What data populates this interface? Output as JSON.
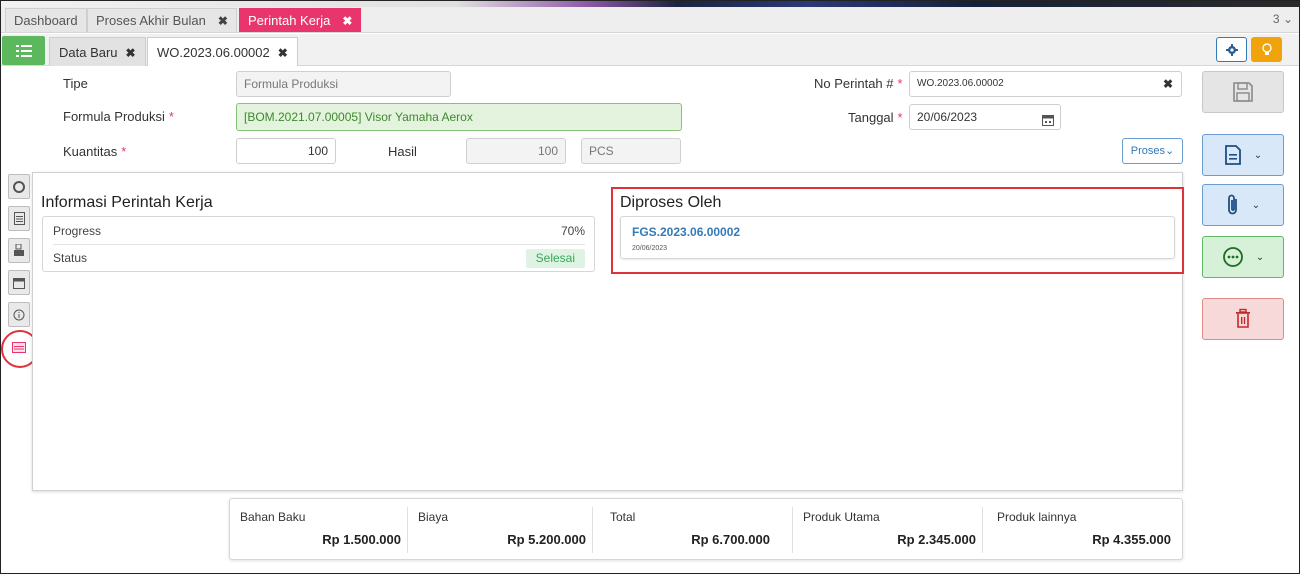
{
  "top_tabs": [
    {
      "label": "Dashboard",
      "closable": false
    },
    {
      "label": "Proses Akhir Bulan",
      "closable": true
    },
    {
      "label": "Perintah Kerja",
      "closable": true
    }
  ],
  "top_tab_count": "3",
  "sub_tabs": [
    {
      "label": "Data Baru",
      "closable": true
    },
    {
      "label": "WO.2023.06.00002",
      "closable": true
    }
  ],
  "form": {
    "tipe_label": "Tipe",
    "tipe_value": "Formula Produksi",
    "formula_label": "Formula Produksi",
    "formula_value": "[BOM.2021.07.00005] Visor Yamaha Aerox",
    "kuantitas_label": "Kuantitas",
    "kuantitas_value": "100",
    "hasil_label": "Hasil",
    "hasil_value": "100",
    "unit_value": "PCS",
    "no_perintah_label": "No Perintah #",
    "no_perintah_value": "WO.2023.06.00002",
    "tanggal_label": "Tanggal",
    "tanggal_value": "20/06/2023",
    "required_mark": "*",
    "proses_button": "Proses"
  },
  "info": {
    "title": "Informasi Perintah Kerja",
    "progress_label": "Progress",
    "progress_value": "70%",
    "status_label": "Status",
    "status_value": "Selesai"
  },
  "diproses": {
    "title": "Diproses Oleh",
    "doc_number": "FGS.2023.06.00002",
    "doc_date": "20/06/2023"
  },
  "summary": [
    {
      "label": "Bahan Baku",
      "value": "Rp 1.500.000"
    },
    {
      "label": "Biaya",
      "value": "Rp 5.200.000"
    },
    {
      "label": "Total",
      "value": "Rp 6.700.000"
    },
    {
      "label": "Produk Utama",
      "value": "Rp 2.345.000"
    },
    {
      "label": "Produk lainnya",
      "value": "Rp 4.355.000"
    }
  ],
  "colors": {
    "accent_pink": "#e8356d",
    "menu_green": "#5cb85c",
    "highlight_red": "#e0303a",
    "link_blue": "#337ab7",
    "bulb_orange": "#f0a30a"
  },
  "icons": {
    "menu": "list-icon",
    "settings": "gear-icon",
    "tips": "lightbulb-icon",
    "save": "floppy-disk-icon",
    "document": "document-icon",
    "attachment": "paperclip-icon",
    "more": "ellipsis-circle-icon",
    "delete": "trash-icon",
    "calendar": "calendar-icon"
  }
}
